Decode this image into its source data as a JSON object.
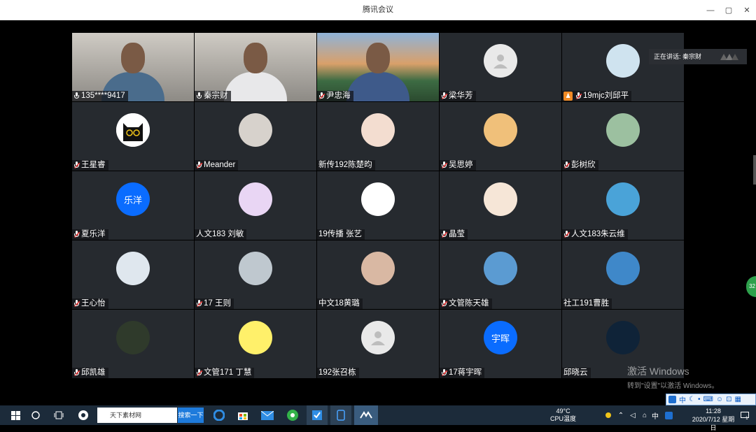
{
  "window": {
    "title": "腾讯会议",
    "controls": [
      "—",
      "▢",
      "✕"
    ]
  },
  "speaking": {
    "label": "正在讲话: 秦宗财"
  },
  "participants": [
    {
      "name": "135****9417",
      "type": "video",
      "mic": "on",
      "avatar": null
    },
    {
      "name": "秦宗财",
      "type": "video",
      "mic": "on",
      "active": true,
      "avatar": null
    },
    {
      "name": "尹忠海",
      "type": "video",
      "mic": "muted",
      "avatar": null
    },
    {
      "name": "梁华芳",
      "type": "avatar",
      "mic": "muted",
      "avatar": "default-person-icon"
    },
    {
      "name": "19mjc刘邱平",
      "type": "avatar",
      "mic": "muted",
      "host": true,
      "avatar": "white-horse-icon"
    },
    {
      "name": "王星睿",
      "type": "avatar",
      "mic": "muted",
      "avatar": "black-cat-icon"
    },
    {
      "name": "Meander",
      "type": "avatar",
      "mic": "muted",
      "avatar": "girl-photo-icon"
    },
    {
      "name": "新传192陈楚昀",
      "type": "avatar",
      "mic": "none",
      "avatar": "cartoon-girl-icon"
    },
    {
      "name": "吴思婷",
      "type": "avatar",
      "mic": "muted",
      "avatar": "cartoon-hat-icon"
    },
    {
      "name": "彭树欣",
      "type": "avatar",
      "mic": "muted",
      "avatar": "flowers-icon"
    },
    {
      "name": "夏乐洋",
      "type": "text",
      "mic": "muted",
      "avatar_text": "乐洋"
    },
    {
      "name": "人文183  刘敏",
      "type": "avatar",
      "mic": "none",
      "avatar": "pink-cartoon-icon"
    },
    {
      "name": "19传播 张艺",
      "type": "avatar",
      "mic": "none",
      "avatar": "red-hood-icon"
    },
    {
      "name": "晶莹",
      "type": "avatar",
      "mic": "muted",
      "avatar": "anime-girl-icon"
    },
    {
      "name": "人文183朱云维",
      "type": "avatar",
      "mic": "muted",
      "avatar": "anime-scene-icon"
    },
    {
      "name": "王心怡",
      "type": "avatar",
      "mic": "muted",
      "avatar": "white-wolf-icon"
    },
    {
      "name": "17 王则",
      "type": "avatar",
      "mic": "muted",
      "avatar": "person-outdoor-icon"
    },
    {
      "name": "中文18黄璐",
      "type": "avatar",
      "mic": "none",
      "avatar": "woman-portrait-icon"
    },
    {
      "name": "文管陈天雄",
      "type": "avatar",
      "mic": "muted",
      "avatar": "bird-sky-icon"
    },
    {
      "name": "社工191曹胜",
      "type": "avatar",
      "mic": "none",
      "avatar": "ocean-wave-icon"
    },
    {
      "name": "邱凯雄",
      "type": "avatar",
      "mic": "muted",
      "avatar": "green-bug-icon"
    },
    {
      "name": "文管171 丁慧",
      "type": "avatar",
      "mic": "muted",
      "avatar": "yellow-cartoon-icon"
    },
    {
      "name": "192张召栋",
      "type": "avatar",
      "mic": "none",
      "avatar": "default-person-icon"
    },
    {
      "name": "17蒋宇晖",
      "type": "text",
      "mic": "muted",
      "avatar_text": "宇晖"
    },
    {
      "name": "邱晓云",
      "type": "avatar",
      "mic": "none",
      "avatar": "night-sky-icon"
    }
  ],
  "side_pill": "32",
  "watermark": {
    "line1": "激活 Windows",
    "line2": "转到\"设置\"以激活 Windows。"
  },
  "ime": {
    "lang": "中"
  },
  "taskbar": {
    "search_placeholder": "天下素材网",
    "search_button": "搜索一下",
    "cpu_temp": "49°C",
    "cpu_label": "CPU温度",
    "tray_lang": "中",
    "time": "11:28",
    "date": "2020/7/12 星期日"
  }
}
